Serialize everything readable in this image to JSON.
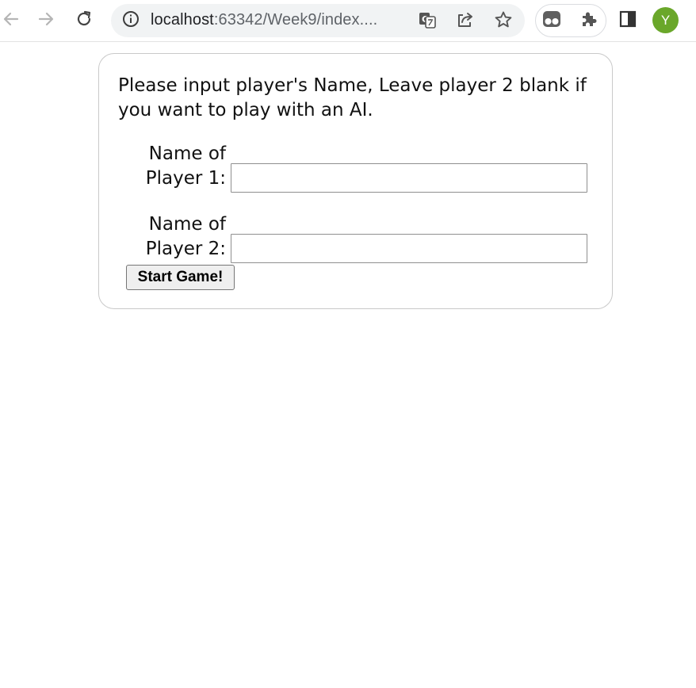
{
  "browser": {
    "url_host": "localhost",
    "url_path": ":63342/Week9/index....",
    "profile_initial": "Y",
    "icons": {
      "back": "arrow-left-icon",
      "forward": "arrow-right-icon",
      "reload": "reload-icon",
      "site_info": "info-icon",
      "translate": "translate-icon",
      "share": "share-icon",
      "bookmark": "star-icon",
      "extension_1": "glasses-extension-icon",
      "extensions": "puzzle-icon",
      "side_panel": "side-panel-icon"
    },
    "colors": {
      "avatar": "#6aa72a",
      "omnibox_bg": "#f1f3f4"
    }
  },
  "page": {
    "instructions": "Please input player's Name, Leave player 2 blank if you want to play with an AI.",
    "player1_label_line1": "Name of",
    "player1_label_line2": "Player 1:",
    "player1_value": "",
    "player2_label_line1": "Name of",
    "player2_label_line2": "Player 2:",
    "player2_value": "",
    "start_button": "Start Game!"
  }
}
